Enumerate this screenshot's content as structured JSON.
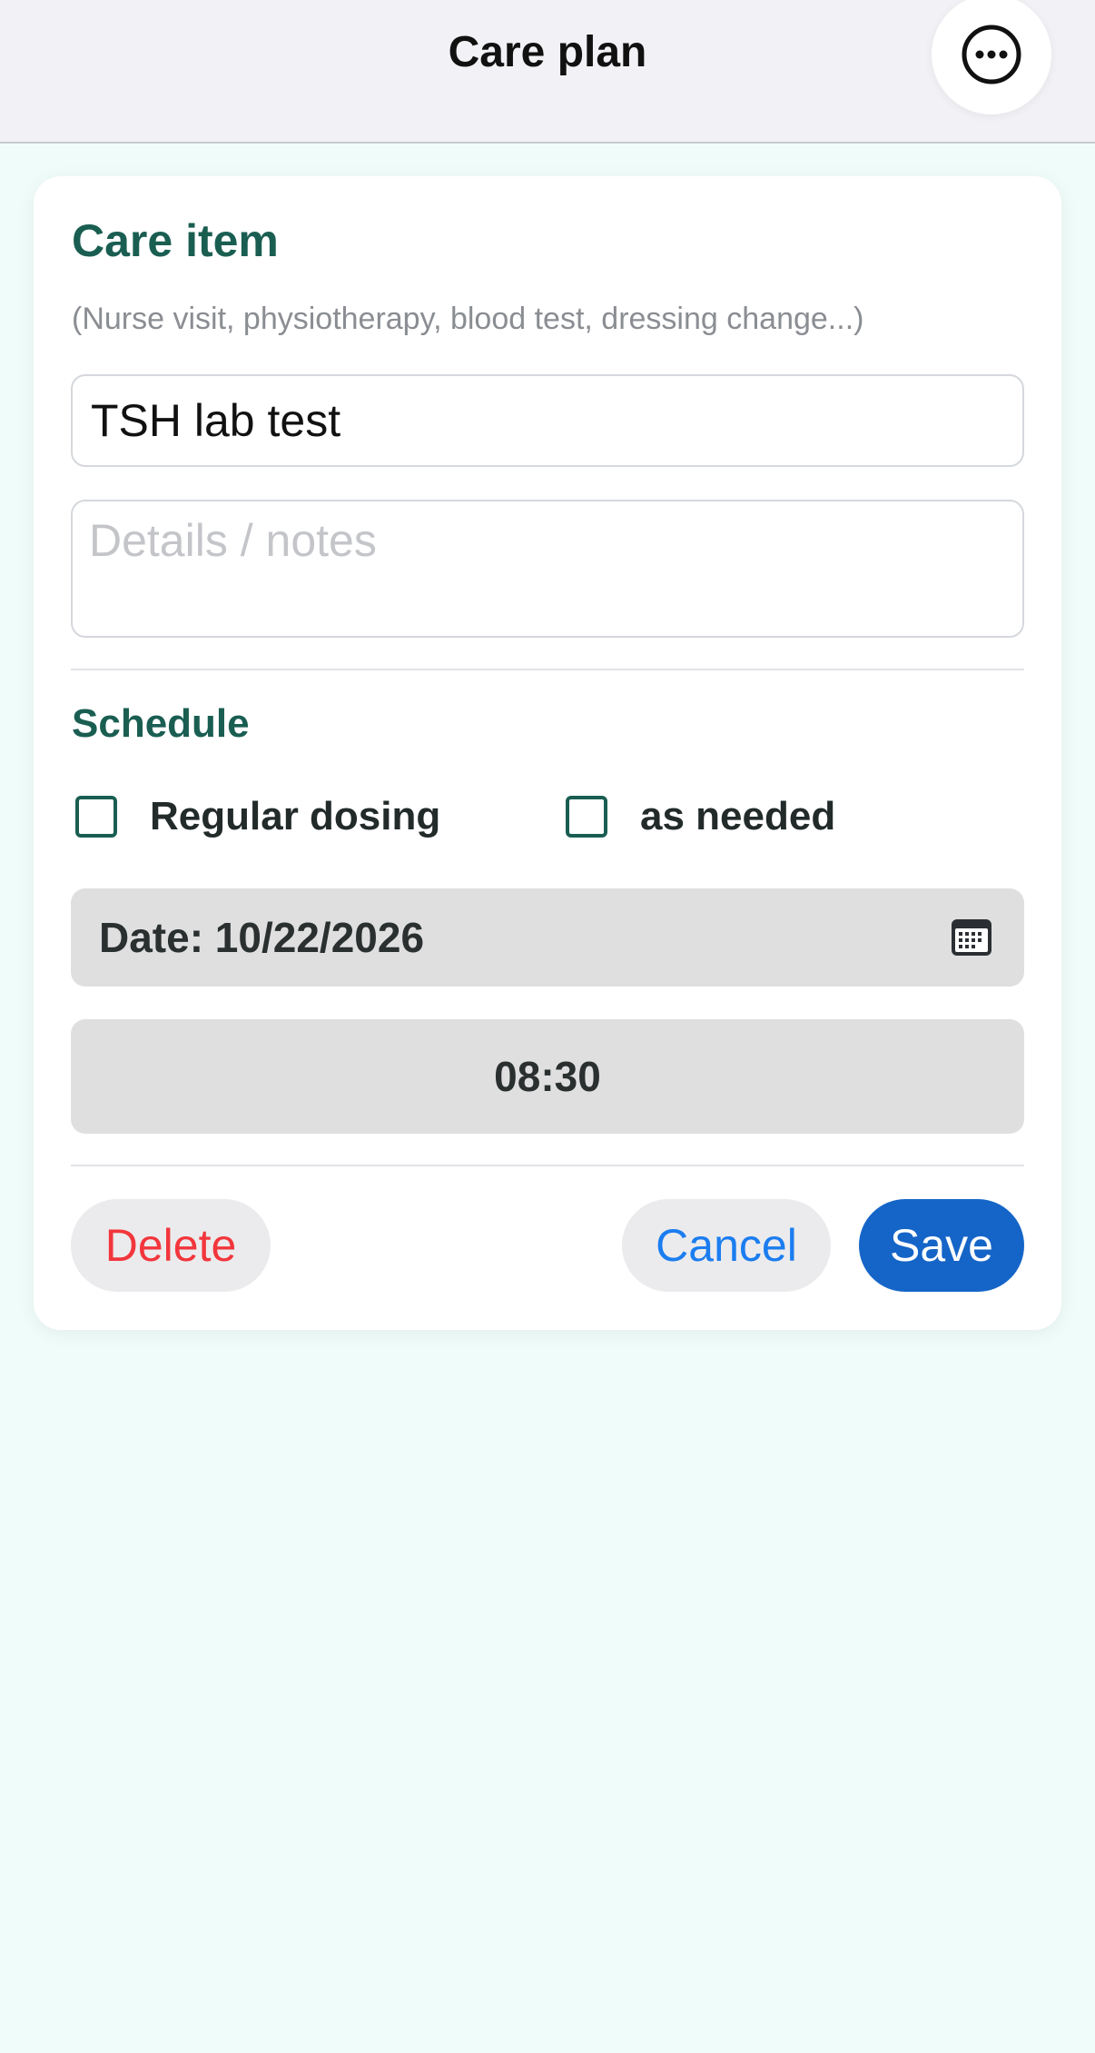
{
  "header": {
    "title": "Care plan"
  },
  "form": {
    "section_title": "Care item",
    "hint": "(Nurse visit, physiotherapy, blood test, dressing change...)",
    "name_value": "TSH lab test",
    "notes_placeholder": "Details / notes",
    "notes_value": ""
  },
  "schedule": {
    "title": "Schedule",
    "options": [
      {
        "label": "Regular dosing",
        "checked": false
      },
      {
        "label": "as needed",
        "checked": false
      }
    ],
    "date_text": "Date: 10/22/2026",
    "time_text": "08:30"
  },
  "actions": {
    "delete_label": "Delete",
    "cancel_label": "Cancel",
    "save_label": "Save"
  },
  "colors": {
    "accent_green": "#1a5e52",
    "delete_red": "#f2363c",
    "cancel_blue": "#1b7df0",
    "save_blue": "#1565c8",
    "background": "#f0fcf9"
  },
  "icons": {
    "more": "more-horizontal-circle-icon",
    "calendar": "calendar-icon"
  }
}
